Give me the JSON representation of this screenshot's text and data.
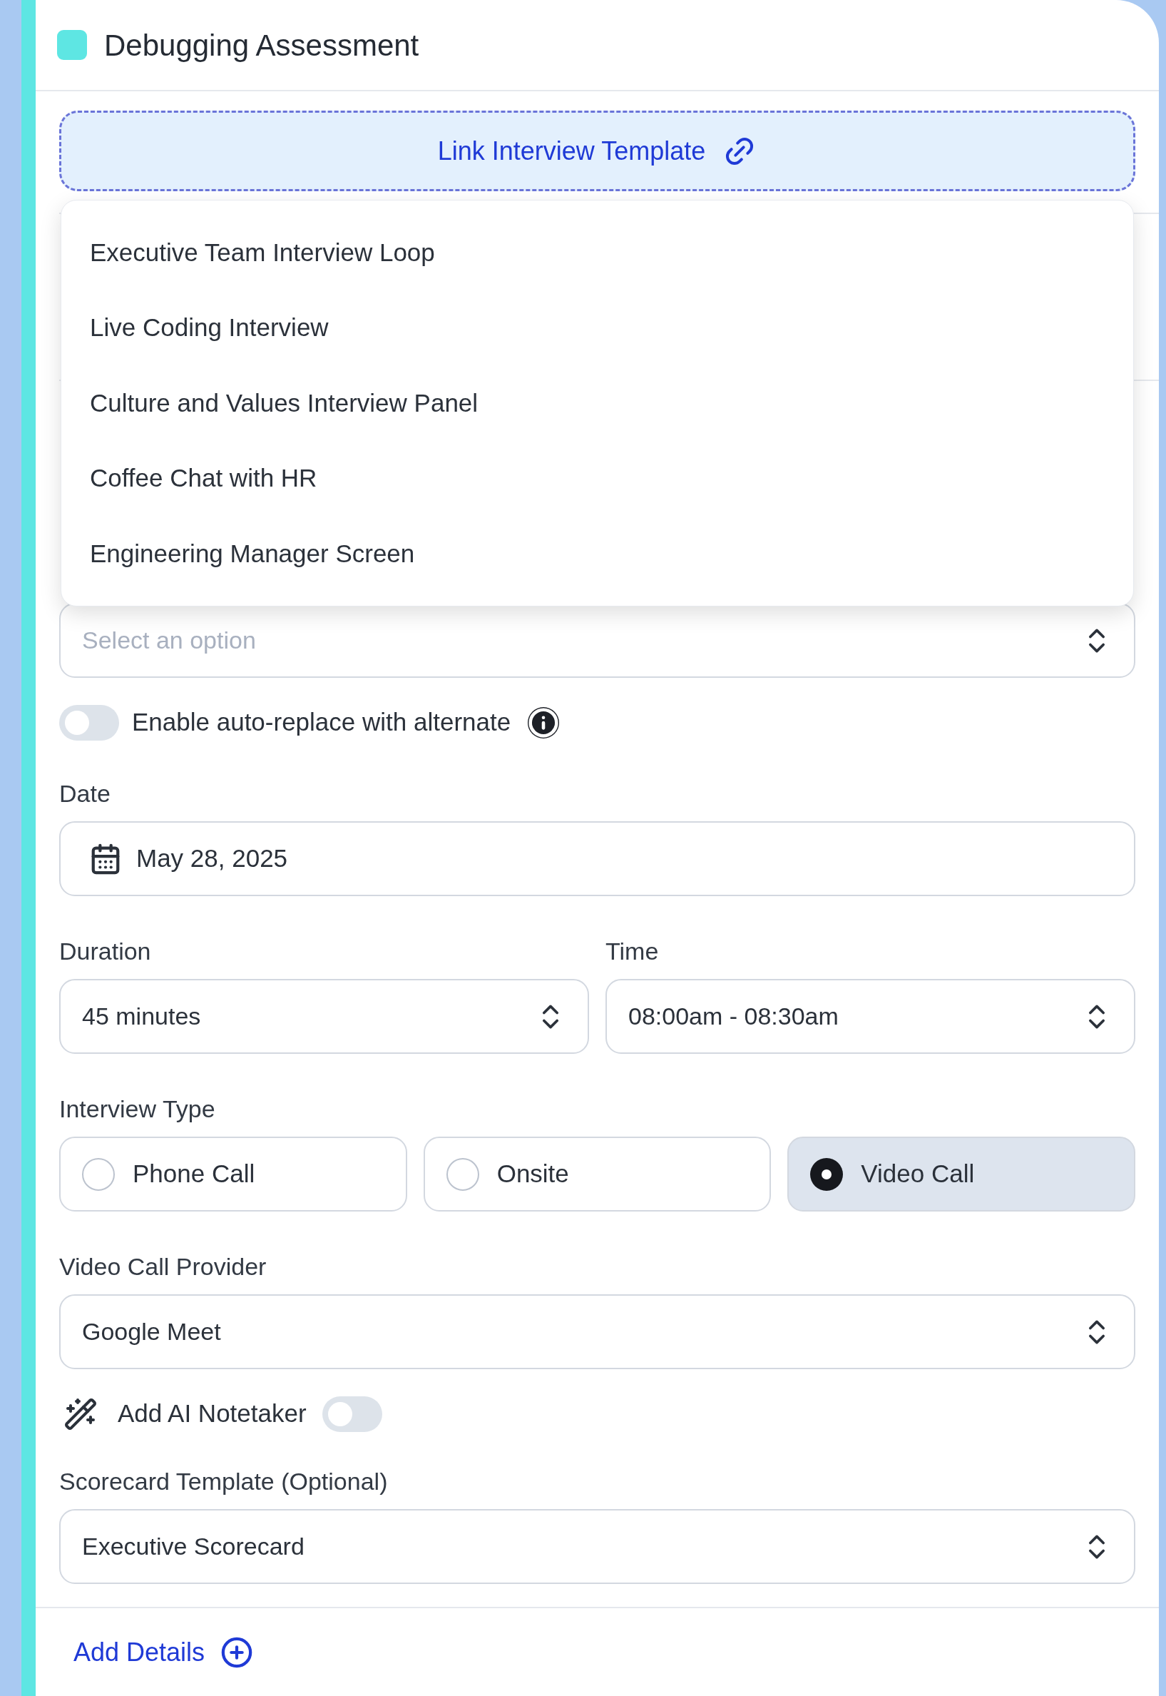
{
  "header": {
    "title": "Debugging Assessment",
    "color": "#5ee6e3"
  },
  "link_template_button": {
    "label": "Link Interview Template"
  },
  "template_menu": {
    "items": [
      {
        "label": "Executive Team Interview Loop"
      },
      {
        "label": "Live Coding Interview"
      },
      {
        "label": "Culture and Values Interview Panel"
      },
      {
        "label": "Coffee Chat with HR"
      },
      {
        "label": "Engineering Manager Screen"
      }
    ]
  },
  "interviewer_select": {
    "placeholder": "Select an option"
  },
  "auto_replace": {
    "label": "Enable auto-replace with alternate",
    "on": false
  },
  "date": {
    "label": "Date",
    "value": "May 28, 2025"
  },
  "duration": {
    "label": "Duration",
    "value": "45 minutes"
  },
  "time": {
    "label": "Time",
    "value": "08:00am - 08:30am"
  },
  "interview_type": {
    "label": "Interview Type",
    "options": [
      {
        "label": "Phone Call",
        "selected": false
      },
      {
        "label": "Onsite",
        "selected": false
      },
      {
        "label": "Video Call",
        "selected": true
      }
    ]
  },
  "video_provider": {
    "label": "Video Call Provider",
    "value": "Google Meet"
  },
  "ai_notetaker": {
    "label": "Add AI Notetaker",
    "on": false
  },
  "scorecard": {
    "label": "Scorecard Template (Optional)",
    "value": "Executive Scorecard"
  },
  "add_details": {
    "label": "Add Details"
  }
}
